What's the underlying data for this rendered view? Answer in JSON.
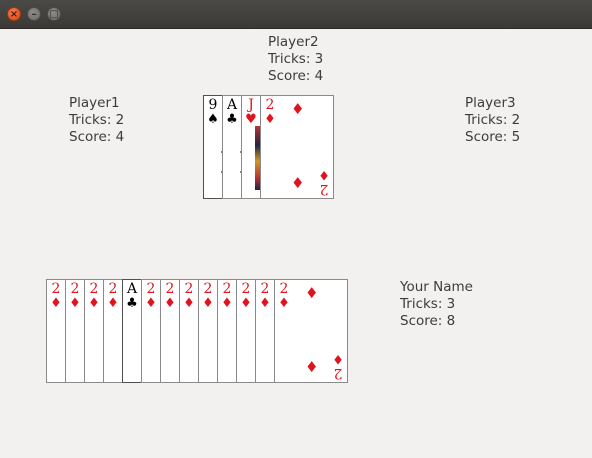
{
  "window": {
    "controls": {
      "close": "×",
      "minimize": "–",
      "maximize": "□"
    }
  },
  "players": {
    "player2": {
      "name": "Player2",
      "tricks": "Tricks: 3",
      "score": "Score: 4"
    },
    "player1": {
      "name": "Player1",
      "tricks": "Tricks: 2",
      "score": "Score: 4"
    },
    "player3": {
      "name": "Player3",
      "tricks": "Tricks: 2",
      "score": "Score: 5"
    },
    "you": {
      "name": "Your Name",
      "tricks": "Tricks: 3",
      "score": "Score: 8"
    }
  },
  "table": {
    "cards": [
      {
        "rank": "9",
        "suit": "♠",
        "color": "#000000"
      },
      {
        "rank": "A",
        "suit": "♣",
        "color": "#000000"
      },
      {
        "rank": "J",
        "suit": "♥",
        "color": "#e0141e"
      },
      {
        "rank": "2",
        "suit": "♦",
        "color": "#e0141e"
      }
    ]
  },
  "hand": {
    "cards": [
      {
        "rank": "2",
        "suit": "♦",
        "color": "#e0141e"
      },
      {
        "rank": "2",
        "suit": "♦",
        "color": "#e0141e"
      },
      {
        "rank": "2",
        "suit": "♦",
        "color": "#e0141e"
      },
      {
        "rank": "2",
        "suit": "♦",
        "color": "#e0141e"
      },
      {
        "rank": "A",
        "suit": "♣",
        "color": "#000000"
      },
      {
        "rank": "2",
        "suit": "♦",
        "color": "#e0141e"
      },
      {
        "rank": "2",
        "suit": "♦",
        "color": "#e0141e"
      },
      {
        "rank": "2",
        "suit": "♦",
        "color": "#e0141e"
      },
      {
        "rank": "2",
        "suit": "♦",
        "color": "#e0141e"
      },
      {
        "rank": "2",
        "suit": "♦",
        "color": "#e0141e"
      },
      {
        "rank": "2",
        "suit": "♦",
        "color": "#e0141e"
      },
      {
        "rank": "2",
        "suit": "♦",
        "color": "#e0141e"
      },
      {
        "rank": "2",
        "suit": "♦",
        "color": "#e0141e"
      }
    ]
  }
}
